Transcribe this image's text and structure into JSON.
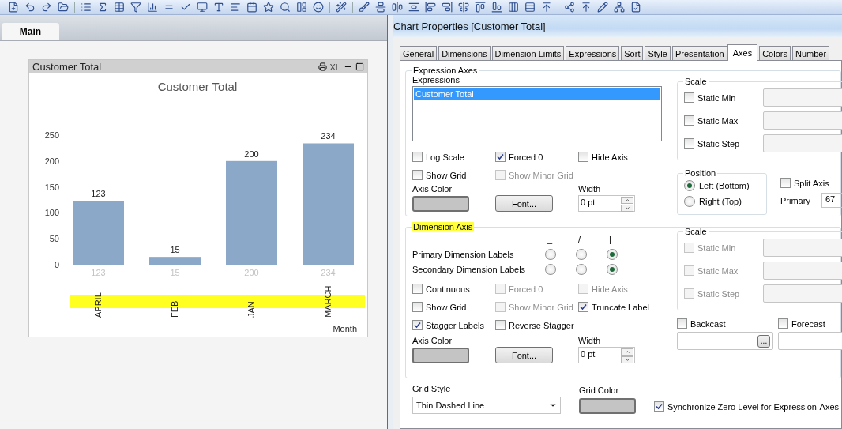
{
  "sheet_tabs": [
    {
      "label": "Main",
      "selected": true
    }
  ],
  "chart_object": {
    "caption": "Customer Total",
    "export_label": "XL",
    "value_row": [
      "123",
      "15",
      "200",
      "234"
    ],
    "chart_data": {
      "type": "bar",
      "title": "Customer Total",
      "xlabel": "Month",
      "categories": [
        "APRIL",
        "FEB",
        "JAN",
        "MARCH"
      ],
      "values": [
        123,
        15,
        200,
        234
      ],
      "ylim": [
        0,
        250
      ],
      "yticks": [
        0,
        50,
        100,
        150,
        200,
        250
      ],
      "value_labels": [
        "123",
        "15",
        "200",
        "234"
      ]
    }
  },
  "dialog": {
    "title": "Chart Properties [Customer Total]",
    "tabs": [
      {
        "label": "General",
        "selected": false
      },
      {
        "label": "Dimensions",
        "selected": false
      },
      {
        "label": "Dimension Limits",
        "selected": false
      },
      {
        "label": "Expressions",
        "selected": false
      },
      {
        "label": "Sort",
        "selected": false
      },
      {
        "label": "Style",
        "selected": false
      },
      {
        "label": "Presentation",
        "selected": false
      },
      {
        "label": "Axes",
        "selected": true
      },
      {
        "label": "Colors",
        "selected": false
      },
      {
        "label": "Number",
        "selected": false
      }
    ],
    "expression_axes": {
      "title": "Expression Axes",
      "list_label": "Expressions",
      "expressions": [
        {
          "label": "Customer Total",
          "selected": true
        }
      ],
      "checkboxes": [
        {
          "label": "Log Scale",
          "checked": false,
          "disabled": false
        },
        {
          "label": "Forced 0",
          "checked": true,
          "disabled": false
        },
        {
          "label": "Hide Axis",
          "checked": false,
          "disabled": false
        },
        {
          "label": "Show Grid",
          "checked": false,
          "disabled": false
        },
        {
          "label": "Show Minor Grid",
          "checked": false,
          "disabled": true
        }
      ],
      "axis_color_label": "Axis Color",
      "font_button": "Font...",
      "width_label": "Width",
      "width_value": "0 pt",
      "scale": {
        "title": "Scale",
        "rows": [
          {
            "label": "Static Min",
            "checked": false,
            "disabled": false
          },
          {
            "label": "Static Max",
            "checked": false,
            "disabled": false
          },
          {
            "label": "Static Step",
            "checked": false,
            "disabled": false
          }
        ]
      },
      "position": {
        "title": "Position",
        "options": [
          {
            "label": "Left (Bottom)",
            "selected": true
          },
          {
            "label": "Right (Top)",
            "selected": false
          }
        ]
      },
      "split_axis": {
        "label": "Split Axis",
        "checked": false
      },
      "primary_label": "Primary",
      "primary_value": "67"
    },
    "dimension_axis": {
      "title": "Dimension Axis",
      "orientation_headers": [
        "_",
        "/",
        "|"
      ],
      "label_rows": [
        {
          "label": "Primary Dimension Labels",
          "options": [
            {
              "selected": false
            },
            {
              "selected": false
            },
            {
              "selected": true
            }
          ]
        },
        {
          "label": "Secondary Dimension Labels",
          "options": [
            {
              "selected": false
            },
            {
              "selected": false
            },
            {
              "selected": true
            }
          ]
        }
      ],
      "checkboxes": [
        {
          "label": "Continuous",
          "checked": false,
          "disabled": false
        },
        {
          "label": "Forced 0",
          "checked": false,
          "disabled": true
        },
        {
          "label": "Hide Axis",
          "checked": false,
          "disabled": true
        },
        {
          "label": "Show Grid",
          "checked": false,
          "disabled": false
        },
        {
          "label": "Show Minor Grid",
          "checked": false,
          "disabled": true
        },
        {
          "label": "Truncate Label",
          "checked": true,
          "disabled": false
        },
        {
          "label": "Stagger Labels",
          "checked": true,
          "disabled": false
        },
        {
          "label": "Reverse Stagger",
          "checked": false,
          "disabled": false
        }
      ],
      "axis_color_label": "Axis Color",
      "font_button": "Font...",
      "width_label": "Width",
      "width_value": "0 pt",
      "scale": {
        "title": "Scale",
        "rows": [
          {
            "label": "Static Min",
            "checked": false,
            "disabled": true
          },
          {
            "label": "Static Max",
            "checked": false,
            "disabled": true
          },
          {
            "label": "Static Step",
            "checked": false,
            "disabled": true
          }
        ]
      },
      "backcast": {
        "label": "Backcast",
        "checked": false,
        "button": "..."
      },
      "forecast": {
        "label": "Forecast",
        "checked": false
      }
    },
    "grid_style_label": "Grid Style",
    "grid_style_value": "Thin Dashed Line",
    "grid_color_label": "Grid Color",
    "sync_zero": {
      "label": "Synchronize Zero Level for Expression-Axes",
      "checked": true
    }
  }
}
